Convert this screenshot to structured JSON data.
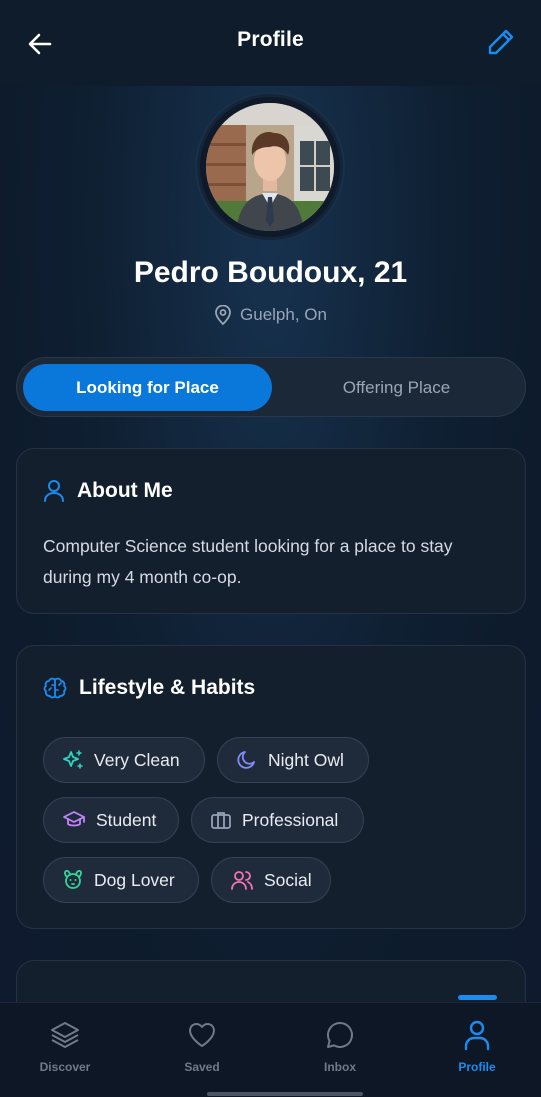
{
  "header": {
    "title": "Profile",
    "back_icon": "arrow-left-icon",
    "edit_icon": "pencil-icon",
    "accent": "#1a8cf0"
  },
  "profile": {
    "name": "Pedro Boudoux, 21",
    "location": "Guelph, On"
  },
  "toggle": {
    "active_label": "Looking for Place",
    "inactive_label": "Offering Place",
    "active_color": "#0a78db"
  },
  "about": {
    "title": "About Me",
    "text": "Computer Science student looking for a place to stay during my 4 month co-op."
  },
  "lifestyle": {
    "title": "Lifestyle & Habits",
    "tags": [
      {
        "label": "Very Clean",
        "icon": "sparkles-icon",
        "color": "#2dd4bf"
      },
      {
        "label": "Night Owl",
        "icon": "moon-icon",
        "color": "#818cf8"
      },
      {
        "label": "Student",
        "icon": "graduation-cap-icon",
        "color": "#c084fc"
      },
      {
        "label": "Professional",
        "icon": "briefcase-icon",
        "color": "#94a3b8"
      },
      {
        "label": "Dog Lover",
        "icon": "dog-icon",
        "color": "#34d399"
      },
      {
        "label": "Social",
        "icon": "users-icon",
        "color": "#f472b6"
      }
    ]
  },
  "nav": {
    "items": [
      {
        "label": "Discover",
        "icon": "layers-icon"
      },
      {
        "label": "Saved",
        "icon": "heart-icon"
      },
      {
        "label": "Inbox",
        "icon": "chat-bubble-icon"
      },
      {
        "label": "Profile",
        "icon": "user-icon"
      }
    ],
    "active": "Profile"
  }
}
